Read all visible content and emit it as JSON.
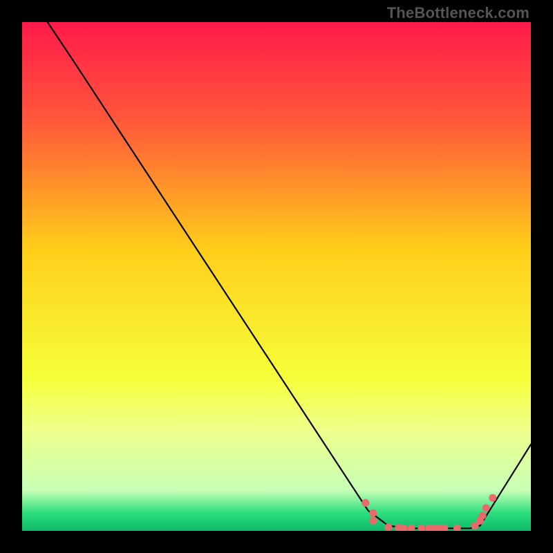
{
  "watermark": "TheBottleneck.com",
  "colors": {
    "black": "#000000",
    "curve": "#000000",
    "marker": "#e86a6a"
  },
  "chart_data": {
    "type": "line",
    "title": "",
    "xlabel": "",
    "ylabel": "",
    "xlim": [
      0,
      100
    ],
    "ylim": [
      0,
      100
    ],
    "gradient_stops": [
      {
        "offset": 0.0,
        "color": "#ff1a4a"
      },
      {
        "offset": 0.2,
        "color": "#ff5a3a"
      },
      {
        "offset": 0.45,
        "color": "#ffcf1a"
      },
      {
        "offset": 0.7,
        "color": "#f5ff3a"
      },
      {
        "offset": 0.8,
        "color": "#efff8a"
      },
      {
        "offset": 0.92,
        "color": "#c7ffb6"
      },
      {
        "offset": 0.965,
        "color": "#2bde7d"
      },
      {
        "offset": 1.0,
        "color": "#0fb86a"
      }
    ],
    "series": [
      {
        "name": "curve",
        "points": [
          {
            "x": 5.0,
            "y": 100.0
          },
          {
            "x": 10.0,
            "y": 92.5
          },
          {
            "x": 68.0,
            "y": 4.0
          },
          {
            "x": 72.0,
            "y": 1.0
          },
          {
            "x": 76.0,
            "y": 0.5
          },
          {
            "x": 88.0,
            "y": 0.5
          },
          {
            "x": 90.0,
            "y": 1.0
          },
          {
            "x": 100.0,
            "y": 17.0
          }
        ]
      }
    ],
    "markers": [
      {
        "x": 67.5,
        "y": 5.5
      },
      {
        "x": 69.0,
        "y": 3.5
      },
      {
        "x": 69.0,
        "y": 2.0
      },
      {
        "x": 72.0,
        "y": 0.7
      },
      {
        "x": 74.0,
        "y": 0.6
      },
      {
        "x": 75.0,
        "y": 0.5
      },
      {
        "x": 76.5,
        "y": 0.5
      },
      {
        "x": 78.5,
        "y": 0.5
      },
      {
        "x": 80.0,
        "y": 0.5
      },
      {
        "x": 81.0,
        "y": 0.5
      },
      {
        "x": 82.0,
        "y": 0.5
      },
      {
        "x": 83.0,
        "y": 0.5
      },
      {
        "x": 85.5,
        "y": 0.5
      },
      {
        "x": 89.0,
        "y": 1.0
      },
      {
        "x": 90.0,
        "y": 2.0
      },
      {
        "x": 90.5,
        "y": 3.0
      },
      {
        "x": 91.2,
        "y": 4.5
      },
      {
        "x": 92.5,
        "y": 6.5
      }
    ]
  }
}
